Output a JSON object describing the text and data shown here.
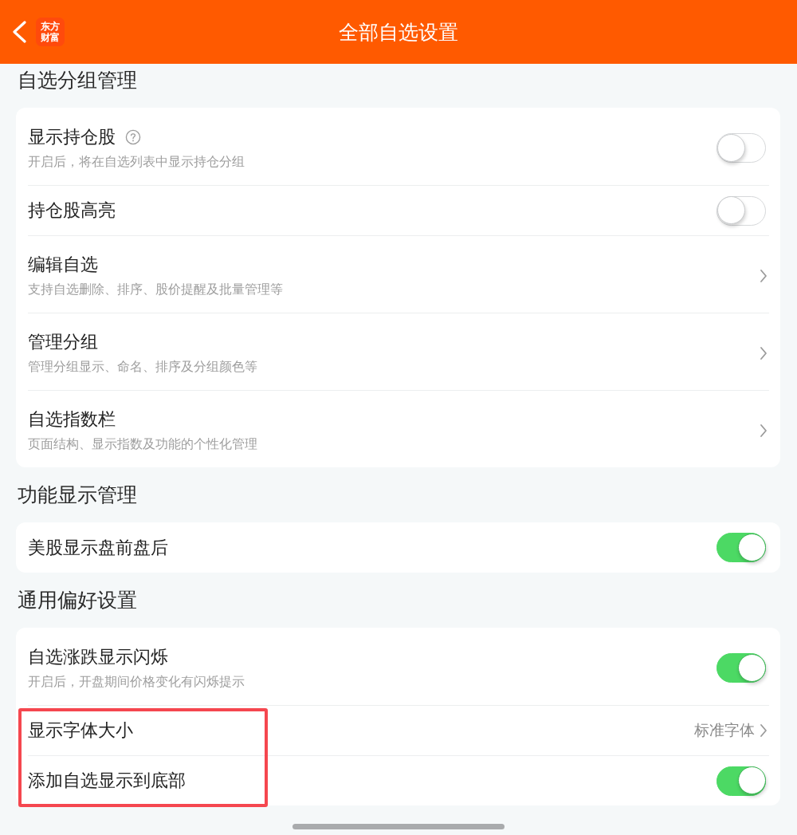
{
  "header": {
    "title": "全部自选设置",
    "logo_lines": [
      "东方",
      "财富"
    ]
  },
  "sections": [
    {
      "heading": "自选分组管理",
      "items": [
        {
          "kind": "toggle",
          "title": "显示持仓股",
          "help": true,
          "subtitle": "开启后，将在自选列表中显示持仓分组",
          "on": false
        },
        {
          "kind": "toggle",
          "title": "持仓股高亮",
          "help": false,
          "on": false
        },
        {
          "kind": "link",
          "title": "编辑自选",
          "help": false,
          "subtitle": "支持自选删除、排序、股价提醒及批量管理等"
        },
        {
          "kind": "link",
          "title": "管理分组",
          "help": false,
          "subtitle": "管理分组显示、命名、排序及分组颜色等"
        },
        {
          "kind": "link",
          "title": "自选指数栏",
          "help": false,
          "subtitle": "页面结构、显示指数及功能的个性化管理"
        }
      ]
    },
    {
      "heading": "功能显示管理",
      "items": [
        {
          "kind": "toggle",
          "title": "美股显示盘前盘后",
          "help": false,
          "on": true
        }
      ]
    },
    {
      "heading": "通用偏好设置",
      "items": [
        {
          "kind": "toggle",
          "title": "自选涨跌显示闪烁",
          "help": false,
          "subtitle": "开启后，开盘期间价格变化有闪烁提示",
          "on": true,
          "highlighted": false
        },
        {
          "kind": "link",
          "title": "显示字体大小",
          "help": false,
          "value": "标准字体",
          "highlighted": true
        },
        {
          "kind": "toggle",
          "title": "添加自选显示到底部",
          "help": false,
          "on": true,
          "highlighted": true
        }
      ]
    }
  ]
}
